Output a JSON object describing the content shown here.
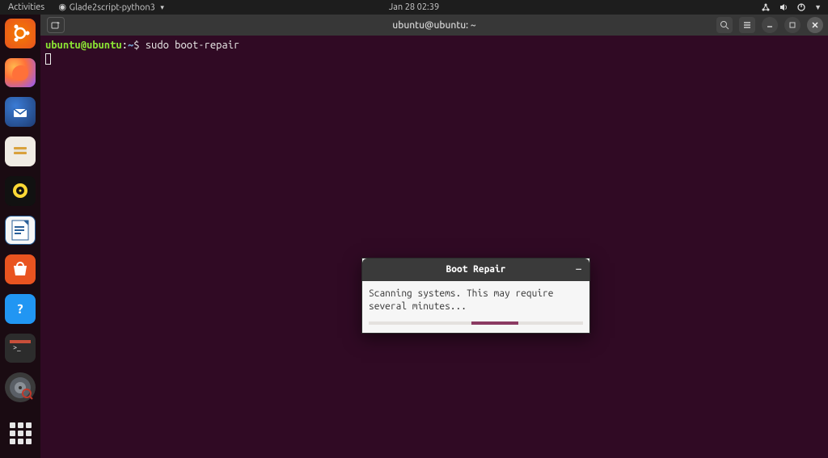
{
  "topbar": {
    "activities": "Activities",
    "app_menu": "Glade2script-python3",
    "datetime": "Jan 28  02:39"
  },
  "dock": {
    "items": [
      {
        "name": "ubuntu-dash",
        "label": "Show Applications"
      },
      {
        "name": "firefox",
        "label": "Firefox"
      },
      {
        "name": "thunderbird",
        "label": "Thunderbird"
      },
      {
        "name": "files",
        "label": "Files"
      },
      {
        "name": "rhythmbox",
        "label": "Rhythmbox"
      },
      {
        "name": "libreoffice-writer",
        "label": "LibreOffice Writer"
      },
      {
        "name": "software",
        "label": "Ubuntu Software"
      },
      {
        "name": "help",
        "label": "Help"
      },
      {
        "name": "terminal",
        "label": "Terminal"
      },
      {
        "name": "boot-repair",
        "label": "Boot Repair"
      }
    ]
  },
  "terminal": {
    "title": "ubuntu@ubuntu: ~",
    "prompt_user": "ubuntu",
    "prompt_at": "@",
    "prompt_host": "ubuntu",
    "prompt_colon": ":",
    "prompt_path": "~",
    "prompt_dollar": "$ ",
    "command": "sudo boot-repair"
  },
  "dialog": {
    "title": "Boot Repair",
    "message": "Scanning systems. This may require several minutes..."
  }
}
